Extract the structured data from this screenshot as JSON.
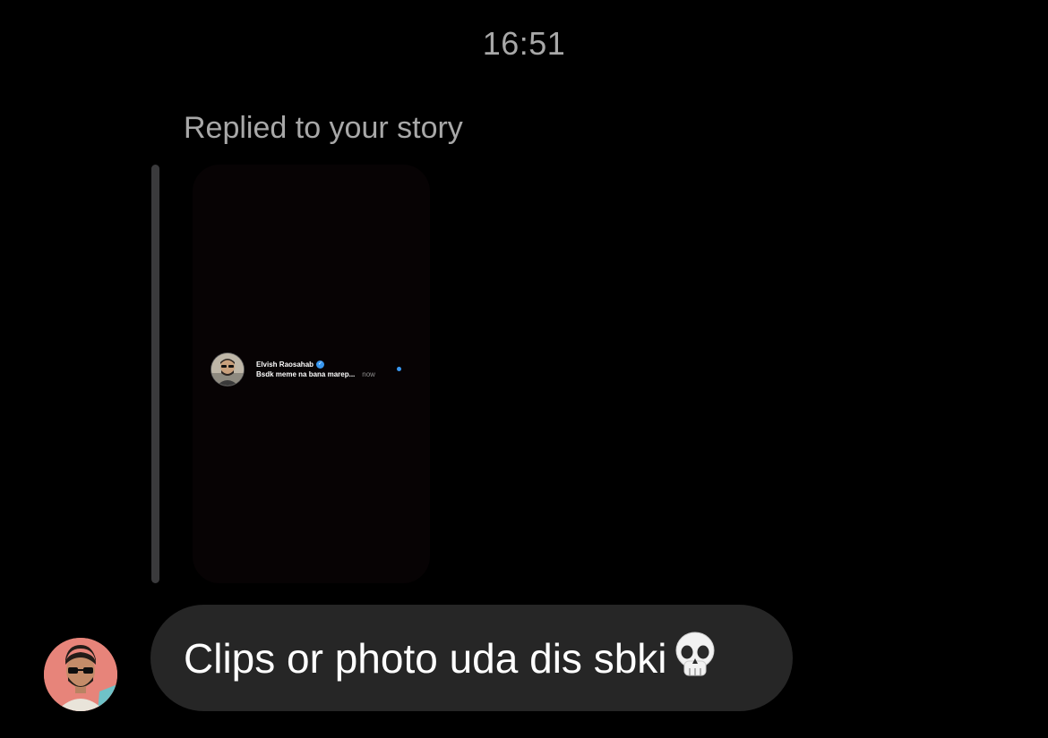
{
  "conversation": {
    "timestamp": "16:51",
    "reply_context": {
      "label": "Replied to your story",
      "story_preview": {
        "notification": {
          "sender_name": "Elvish Raosahab",
          "verified_icon": "verified-badge-icon",
          "message_preview": "Bsdk meme na bana marep...",
          "time": "now",
          "unread_indicator": true
        }
      }
    },
    "message": {
      "text": "Clips or photo uda dis sbki",
      "emoji_icon": "skull-emoji"
    },
    "sender_avatar": "avatar-icon"
  },
  "colors": {
    "background": "#000000",
    "bubble": "#262626",
    "meta_text": "#a8a8a8",
    "accent_blue": "#3897f0"
  }
}
